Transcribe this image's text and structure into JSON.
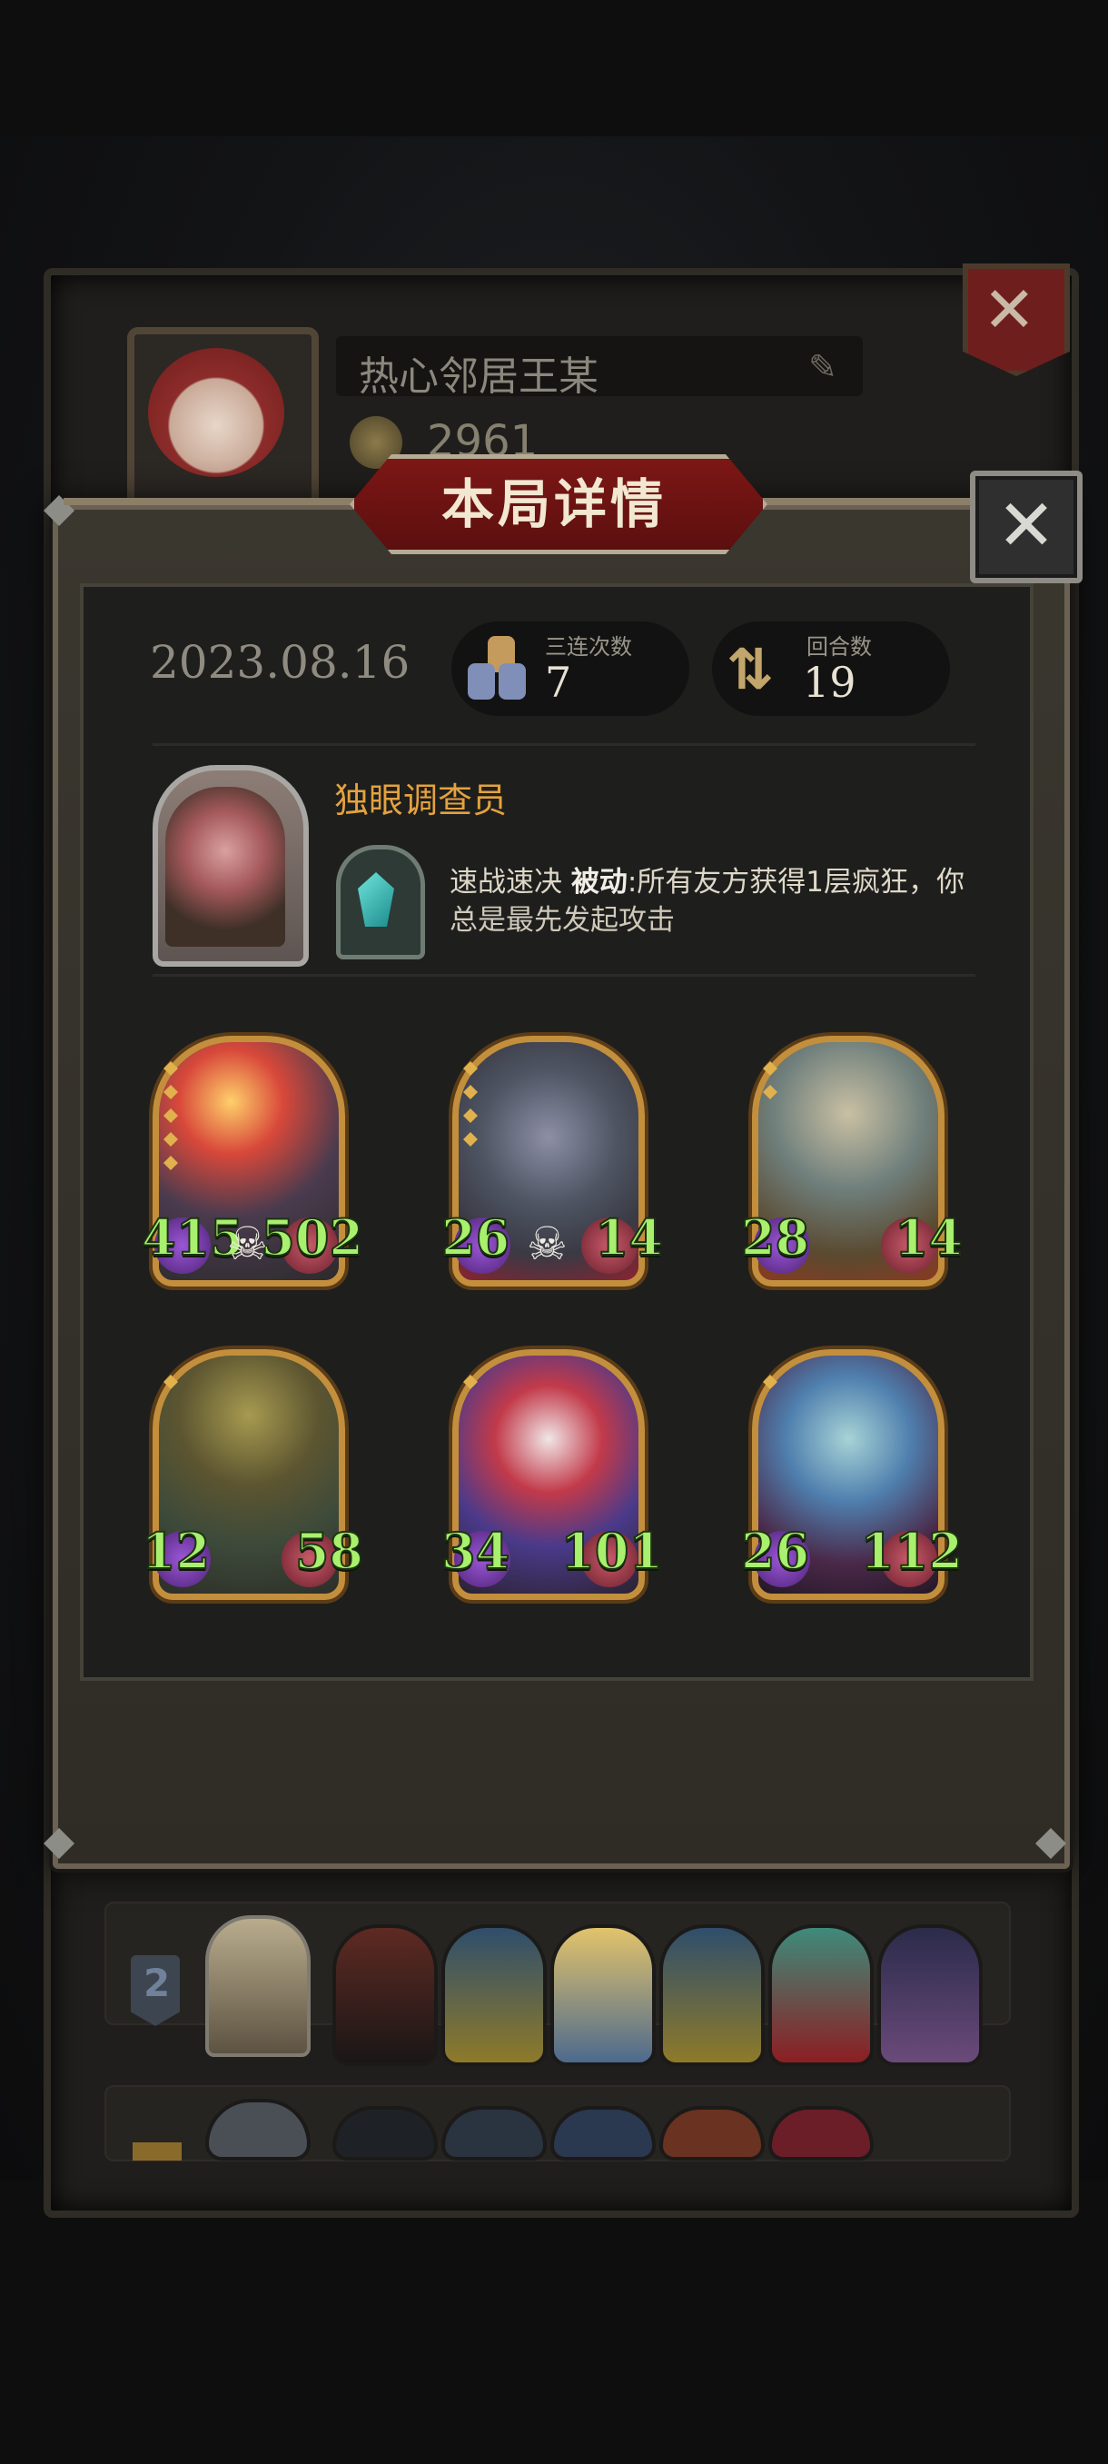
{
  "background_profile": {
    "player_name": "热心邻居王某",
    "coins": "2961",
    "close_icon": "close-icon"
  },
  "background_rows": [
    {
      "rank": "2"
    },
    {
      "rank": ""
    }
  ],
  "modal": {
    "title": "本局详情",
    "close_icon": "close-x-icon",
    "date": "2023.08.16",
    "stats": [
      {
        "label": "三连次数",
        "value": "7",
        "icon": "triple-units-icon"
      },
      {
        "label": "回合数",
        "value": "19",
        "icon": "cycle-arrows-icon"
      }
    ],
    "hero": {
      "name": "独眼调查员",
      "skill_name": "速战速决",
      "skill_kind": "被动",
      "skill_desc_line1": ":所有友方获得1层疯狂，你",
      "skill_desc_line2": "总是最先发起攻击"
    },
    "units": [
      {
        "attack": "415",
        "health": "502",
        "tier_pips": 5,
        "death_mark": true,
        "palette": "flame-bear"
      },
      {
        "attack": "26",
        "health": "14",
        "tier_pips": 4,
        "death_mark": true,
        "palette": "rat-bandit"
      },
      {
        "attack": "28",
        "health": "14",
        "tier_pips": 2,
        "death_mark": false,
        "palette": "airship"
      },
      {
        "attack": "12",
        "health": "58",
        "tier_pips": 1,
        "death_mark": false,
        "palette": "witch-doctor"
      },
      {
        "attack": "34",
        "health": "101",
        "tier_pips": 1,
        "death_mark": false,
        "palette": "jester"
      },
      {
        "attack": "26",
        "health": "112",
        "tier_pips": 1,
        "death_mark": false,
        "palette": "elf-sorceress"
      }
    ]
  },
  "colors": {
    "accent_gold": "#e3a23f",
    "banner_red": "#7c1715",
    "stat_green": "#a8f06d",
    "card_frame": "#c38f3d"
  }
}
